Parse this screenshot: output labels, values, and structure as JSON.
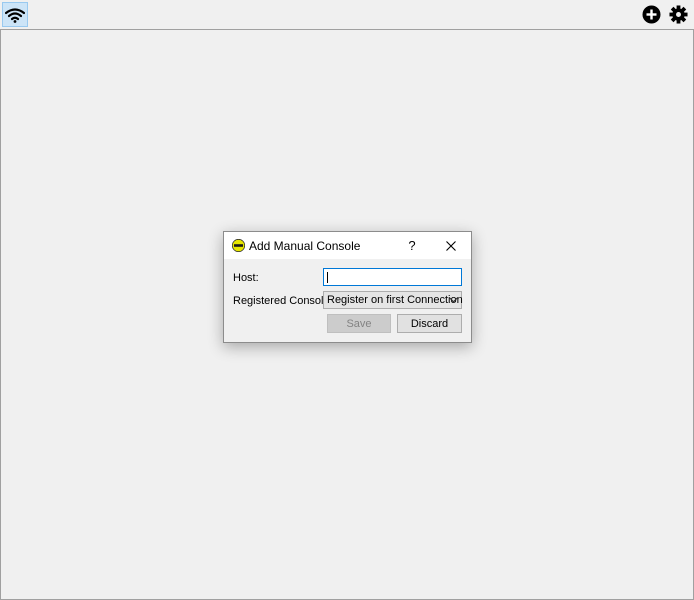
{
  "toolbar": {
    "wifi_icon": "wifi-icon",
    "add_icon": "add-circle-icon",
    "settings_icon": "gear-icon"
  },
  "dialog": {
    "title": "Add Manual Console",
    "help_label": "?",
    "host_label": "Host:",
    "host_value": "",
    "registered_label": "Registered Console:",
    "registered_value": "Register on first Connection",
    "save_label": "Save",
    "discard_label": "Discard"
  },
  "colors": {
    "background": "#f0f0f0",
    "active_toolbar_button": "#cce4f7",
    "focus_border": "#0078d7",
    "app_icon_yellow": "#e6e600"
  }
}
